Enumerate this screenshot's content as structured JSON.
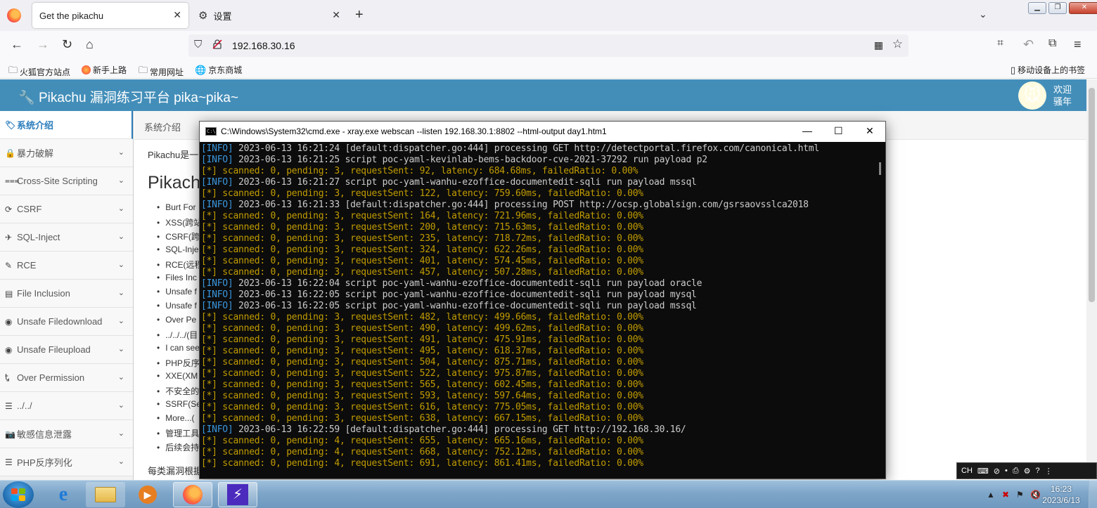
{
  "browser": {
    "tabs": [
      {
        "label": "Get the pikachu",
        "active": true
      },
      {
        "label": "设置",
        "active": false
      }
    ],
    "url": "192.168.30.16",
    "bookmarks": [
      "火狐官方站点",
      "新手上路",
      "常用网址",
      "京东商城"
    ],
    "mobile_bookmarks": "移动设备上的书签"
  },
  "app": {
    "brand": "Pikachu 漏洞练习平台 pika~pika~",
    "welcome_line1": "欢迎",
    "welcome_line2": "骚年",
    "breadcrumb": "系统介绍",
    "intro_prefix": "Pikachu是一",
    "page_title": "Pikach",
    "footer_text": "每类漏洞根据"
  },
  "sidebar": {
    "items": [
      {
        "label": "系统介绍",
        "icon": "tag-icon",
        "active": true
      },
      {
        "label": "暴力破解",
        "icon": "lock-icon"
      },
      {
        "label": "Cross-Site Scripting",
        "icon": "list-icon"
      },
      {
        "label": "CSRF",
        "icon": "refresh-icon"
      },
      {
        "label": "SQL-Inject",
        "icon": "plane-icon"
      },
      {
        "label": "RCE",
        "icon": "pencil-icon"
      },
      {
        "label": "File Inclusion",
        "icon": "file-icon"
      },
      {
        "label": "Unsafe Filedownload",
        "icon": "circle-icon"
      },
      {
        "label": "Unsafe Fileupload",
        "icon": "circle-icon"
      },
      {
        "label": "Over Permission",
        "icon": "text-icon"
      },
      {
        "label": "../../",
        "icon": "menu-icon"
      },
      {
        "label": "敏感信息泄露",
        "icon": "camera-icon"
      },
      {
        "label": "PHP反序列化",
        "icon": "menu-icon"
      }
    ]
  },
  "vuln_list": [
    "Burt For",
    "XSS(跨站",
    "CSRF(跨",
    "SQL-Inje",
    "RCE(远程",
    "Files Inc",
    "Unsafe f",
    "Unsafe f",
    "Over Pe",
    "../../../(目",
    "I can see",
    "PHP反序",
    "XXE(XM",
    "不安全的",
    "SSRF(Se",
    "More...(",
    "管理工具",
    "后续会持"
  ],
  "cmd": {
    "title": "C:\\Windows\\System32\\cmd.exe - xray.exe  webscan --listen 192.168.30.1:8802 --html-output day1.htm1",
    "lines": [
      {
        "type": "info",
        "tag": "[INFO]",
        "text": " 2023-06-13 16:21:24 [default:dispatcher.go:444] processing GET http://detectportal.firefox.com/canonical.html"
      },
      {
        "type": "info",
        "tag": "[INFO]",
        "text": " 2023-06-13 16:21:25 script poc-yaml-kevinlab-bems-backdoor-cve-2021-37292 run payload p2"
      },
      {
        "type": "stat",
        "tag": "[*]",
        "text": " scanned: 0, pending: 3, requestSent: 92, latency: 684.68ms, failedRatio: 0.00%"
      },
      {
        "type": "info",
        "tag": "[INFO]",
        "text": " 2023-06-13 16:21:27 script poc-yaml-wanhu-ezoffice-documentedit-sqli run payload mssql"
      },
      {
        "type": "stat",
        "tag": "[*]",
        "text": " scanned: 0, pending: 3, requestSent: 122, latency: 759.60ms, failedRatio: 0.00%"
      },
      {
        "type": "info",
        "tag": "[INFO]",
        "text": " 2023-06-13 16:21:33 [default:dispatcher.go:444] processing POST http://ocsp.globalsign.com/gsrsaovsslca2018"
      },
      {
        "type": "stat",
        "tag": "[*]",
        "text": " scanned: 0, pending: 3, requestSent: 164, latency: 721.96ms, failedRatio: 0.00%"
      },
      {
        "type": "stat",
        "tag": "[*]",
        "text": " scanned: 0, pending: 3, requestSent: 200, latency: 715.63ms, failedRatio: 0.00%"
      },
      {
        "type": "stat",
        "tag": "[*]",
        "text": " scanned: 0, pending: 3, requestSent: 235, latency: 718.72ms, failedRatio: 0.00%"
      },
      {
        "type": "stat",
        "tag": "[*]",
        "text": " scanned: 0, pending: 3, requestSent: 324, latency: 622.26ms, failedRatio: 0.00%"
      },
      {
        "type": "stat",
        "tag": "[*]",
        "text": " scanned: 0, pending: 3, requestSent: 401, latency: 574.45ms, failedRatio: 0.00%"
      },
      {
        "type": "stat",
        "tag": "[*]",
        "text": " scanned: 0, pending: 3, requestSent: 457, latency: 507.28ms, failedRatio: 0.00%"
      },
      {
        "type": "info",
        "tag": "[INFO]",
        "text": " 2023-06-13 16:22:04 script poc-yaml-wanhu-ezoffice-documentedit-sqli run payload oracle"
      },
      {
        "type": "info",
        "tag": "[INFO]",
        "text": " 2023-06-13 16:22:05 script poc-yaml-wanhu-ezoffice-documentedit-sqli run payload mysql"
      },
      {
        "type": "info",
        "tag": "[INFO]",
        "text": " 2023-06-13 16:22:05 script poc-yaml-wanhu-ezoffice-documentedit-sqli run payload mssql"
      },
      {
        "type": "stat",
        "tag": "[*]",
        "text": " scanned: 0, pending: 3, requestSent: 482, latency: 499.66ms, failedRatio: 0.00%"
      },
      {
        "type": "stat",
        "tag": "[*]",
        "text": " scanned: 0, pending: 3, requestSent: 490, latency: 499.62ms, failedRatio: 0.00%"
      },
      {
        "type": "stat",
        "tag": "[*]",
        "text": " scanned: 0, pending: 3, requestSent: 491, latency: 475.91ms, failedRatio: 0.00%"
      },
      {
        "type": "stat",
        "tag": "[*]",
        "text": " scanned: 0, pending: 3, requestSent: 495, latency: 618.37ms, failedRatio: 0.00%"
      },
      {
        "type": "stat",
        "tag": "[*]",
        "text": " scanned: 0, pending: 3, requestSent: 504, latency: 875.71ms, failedRatio: 0.00%"
      },
      {
        "type": "stat",
        "tag": "[*]",
        "text": " scanned: 0, pending: 3, requestSent: 522, latency: 975.87ms, failedRatio: 0.00%"
      },
      {
        "type": "stat",
        "tag": "[*]",
        "text": " scanned: 0, pending: 3, requestSent: 565, latency: 602.45ms, failedRatio: 0.00%"
      },
      {
        "type": "stat",
        "tag": "[*]",
        "text": " scanned: 0, pending: 3, requestSent: 593, latency: 597.64ms, failedRatio: 0.00%"
      },
      {
        "type": "stat",
        "tag": "[*]",
        "text": " scanned: 0, pending: 3, requestSent: 616, latency: 775.05ms, failedRatio: 0.00%"
      },
      {
        "type": "stat",
        "tag": "[*]",
        "text": " scanned: 0, pending: 3, requestSent: 638, latency: 667.15ms, failedRatio: 0.00%"
      },
      {
        "type": "info",
        "tag": "[INFO]",
        "text": " 2023-06-13 16:22:59 [default:dispatcher.go:444] processing GET http://192.168.30.16/"
      },
      {
        "type": "stat",
        "tag": "[*]",
        "text": " scanned: 0, pending: 4, requestSent: 655, latency: 665.16ms, failedRatio: 0.00%"
      },
      {
        "type": "stat",
        "tag": "[*]",
        "text": " scanned: 0, pending: 4, requestSent: 668, latency: 752.12ms, failedRatio: 0.00%"
      },
      {
        "type": "stat",
        "tag": "[*]",
        "text": " scanned: 0, pending: 4, requestSent: 691, latency: 861.41ms, failedRatio: 0.00%"
      }
    ]
  },
  "langbar": {
    "lang": "CH"
  },
  "taskbar": {
    "time": "16:23",
    "date": "2023/6/13"
  },
  "colors": {
    "header_blue": "#438eb9",
    "info_blue": "#3a96dd",
    "stat_yellow": "#c19c00",
    "active_link": "#2b7dbc"
  }
}
